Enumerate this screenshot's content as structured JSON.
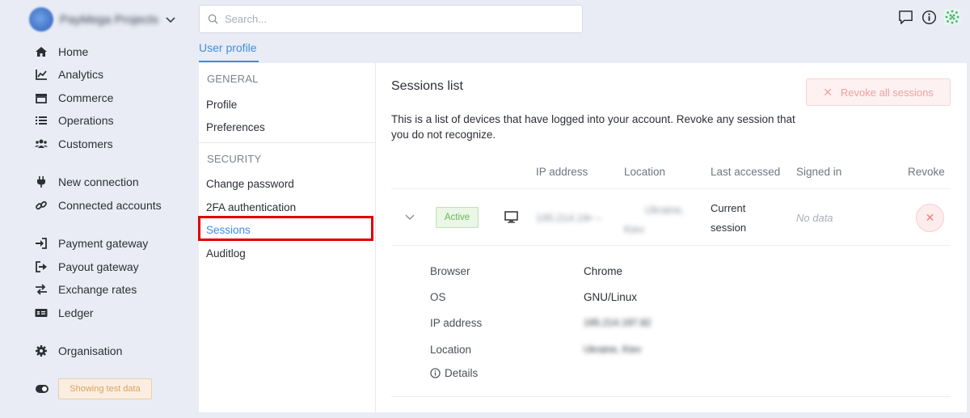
{
  "project": {
    "name": "PayMega Projects"
  },
  "sidebar": {
    "items": [
      {
        "label": "Home",
        "icon": "home-icon"
      },
      {
        "label": "Analytics",
        "icon": "chart-line-icon"
      },
      {
        "label": "Commerce",
        "icon": "store-icon"
      },
      {
        "label": "Operations",
        "icon": "list-icon"
      },
      {
        "label": "Customers",
        "icon": "users-icon"
      },
      {
        "label": "New connection",
        "icon": "plug-icon"
      },
      {
        "label": "Connected accounts",
        "icon": "link-icon"
      },
      {
        "label": "Payment gateway",
        "icon": "sign-in-icon"
      },
      {
        "label": "Payout gateway",
        "icon": "sign-out-icon"
      },
      {
        "label": "Exchange rates",
        "icon": "exchange-icon"
      },
      {
        "label": "Ledger",
        "icon": "money-check-icon"
      },
      {
        "label": "Organisation",
        "icon": "gear-icon"
      }
    ],
    "test_data_label": "Showing test data"
  },
  "search": {
    "placeholder": "Search...",
    "value": ""
  },
  "page": {
    "tab": "User profile"
  },
  "settings_menu": {
    "general_heading": "GENERAL",
    "profile": "Profile",
    "preferences": "Preferences",
    "security_heading": "SECURITY",
    "change_password": "Change password",
    "twofa": "2FA authentication",
    "sessions": "Sessions",
    "auditlog": "Auditlog"
  },
  "sessions": {
    "title": "Sessions list",
    "revoke_all_label": "Revoke all sessions",
    "description": "This is a list of devices that have logged into your account. Revoke any session that you do not recognize.",
    "columns": [
      "IP address",
      "Location",
      "Last accessed",
      "Signed in",
      "Revoke"
    ],
    "row": {
      "status": "Active",
      "ip": "195.214.19• –",
      "location_line1": "Ukraine,",
      "location_line2": "Kiev",
      "last_accessed_line1": "Current",
      "last_accessed_line2": "session",
      "signed_in": "No data"
    },
    "details": {
      "browser_label": "Browser",
      "browser_value": "Chrome",
      "os_label": "OS",
      "os_value": "GNU/Linux",
      "ip_label": "IP address",
      "ip_value": "195.214.197.82",
      "location_label": "Location",
      "location_value": "Ukraine, Kiev",
      "details_link": "Details"
    }
  },
  "colors": {
    "accent": "#3d8ee0",
    "danger": "#ef7d7d",
    "success": "#6cb45b",
    "highlight": "#e00000"
  }
}
